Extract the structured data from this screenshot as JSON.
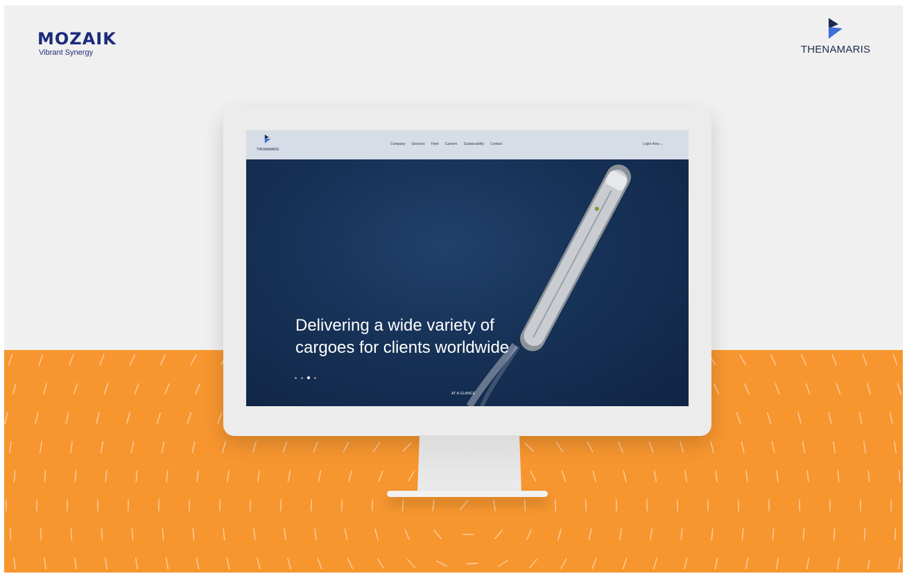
{
  "brand_left": {
    "name": "MOZAIK",
    "tagline": "Vibrant Synergy"
  },
  "brand_right": {
    "name": "THENAMARIS"
  },
  "site": {
    "logo_text": "THENAMARIS",
    "nav": [
      "Company",
      "Services",
      "Fleet",
      "Careers",
      "Sustainability",
      "Contact"
    ],
    "login": "Login Area  ⌄",
    "hero": {
      "line1": "Delivering a wide variety of",
      "line2": "cargoes for clients worldwide",
      "slides_total": 4,
      "active_slide": 3,
      "cta": "AT A GLANCE"
    }
  },
  "colors": {
    "orange": "#f7962f",
    "navy": "#1c2a7c",
    "sea": "#173257",
    "page_bg": "#f0f0f0",
    "nav_bg": "#d7dde6",
    "thenamaris_blue": "#3f6ed8"
  },
  "icons": {
    "zoom": "zoom-in-icon",
    "chevron": "chevron-down-icon"
  }
}
